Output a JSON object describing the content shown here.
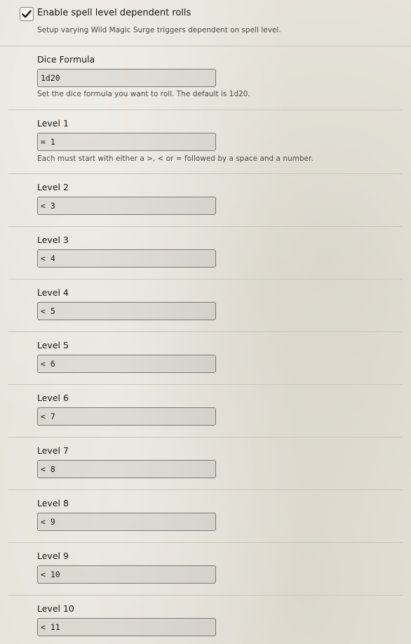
{
  "enable_rolls": {
    "label": "Enable spell level dependent rolls",
    "checked": true,
    "hint": "Setup varying Wild Magic Surge triggers dependent on spell level."
  },
  "dice_formula": {
    "label": "Dice Formula",
    "value": "1d20",
    "hint": "Set the dice formula you want to roll. The default is 1d20."
  },
  "levels": [
    {
      "label": "Level 1",
      "value": "= 1",
      "hint": "Each must start with either a >, < or = followed by a space and a number."
    },
    {
      "label": "Level 2",
      "value": "< 3"
    },
    {
      "label": "Level 3",
      "value": "< 4"
    },
    {
      "label": "Level 4",
      "value": "< 5"
    },
    {
      "label": "Level 5",
      "value": "< 6"
    },
    {
      "label": "Level 6",
      "value": "< 7"
    },
    {
      "label": "Level 7",
      "value": "< 8"
    },
    {
      "label": "Level 8",
      "value": "< 9"
    },
    {
      "label": "Level 9",
      "value": "< 10"
    },
    {
      "label": "Level 10",
      "value": "< 11"
    }
  ]
}
